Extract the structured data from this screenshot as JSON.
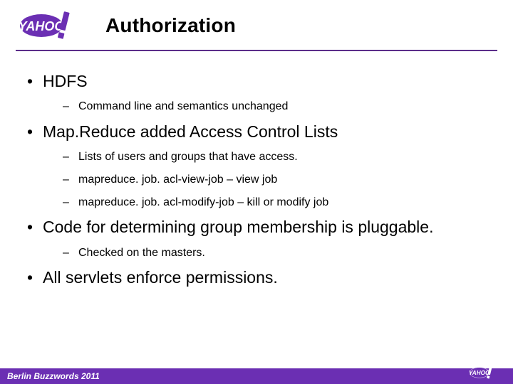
{
  "header": {
    "title": "Authorization",
    "logo_name": "yahoo-logo"
  },
  "bullets": [
    {
      "text": "HDFS",
      "sub": [
        "Command line and semantics unchanged"
      ]
    },
    {
      "text": "Map.Reduce added Access Control Lists",
      "sub": [
        "Lists of users and groups that have access.",
        "mapreduce. job. acl-view-job – view job",
        "mapreduce. job. acl-modify-job – kill or modify job"
      ]
    },
    {
      "text": "Code for determining group membership is pluggable.",
      "sub": [
        "Checked on the masters."
      ]
    },
    {
      "text": "All servlets enforce permissions.",
      "sub": []
    }
  ],
  "footer": {
    "text": "Berlin Buzzwords 2011",
    "logo_name": "yahoo-logo"
  }
}
